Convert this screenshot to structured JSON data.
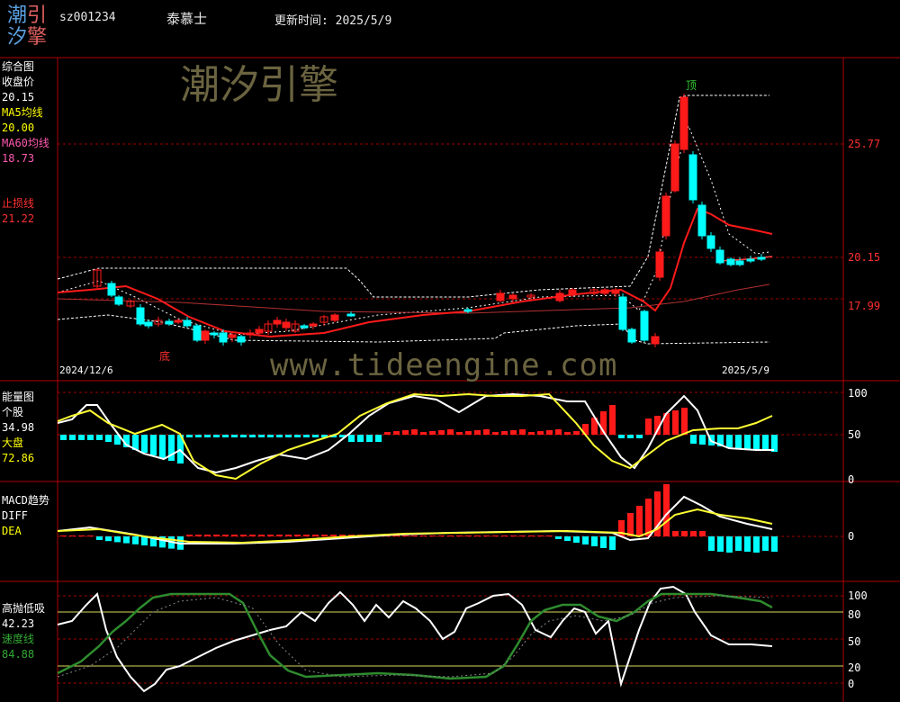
{
  "logo": {
    "chars": [
      "潮",
      "引",
      "汐",
      "擎"
    ]
  },
  "header": {
    "code": "sz001234",
    "name": "泰慕士",
    "update": "更新时间: 2025/5/9"
  },
  "watermarks": {
    "cn": "潮汐引擎",
    "url": "www.tideengine.com"
  },
  "panel1": {
    "title": "综合图",
    "close_label": "收盘价",
    "close_value": "20.15",
    "ma5_label": "MA5均线",
    "ma5_value": "20.00",
    "ma60_label": "MA60均线",
    "ma60_value": "18.73",
    "stop_label": "止损线",
    "stop_value": "21.22",
    "price_ticks": [
      "25.77",
      "20.15",
      "17.99"
    ],
    "date_start": "2024/12/6",
    "date_end": "2025/5/9",
    "mark_top": "顶",
    "mark_bottom": "底"
  },
  "panel2": {
    "title": "能量图",
    "stock_label": "个股",
    "stock_value": "34.98",
    "market_label": "大盘",
    "market_value": "72.86",
    "ticks": [
      "100",
      "50",
      "0"
    ]
  },
  "panel3": {
    "title": "MACD趋势",
    "diff_label": "DIFF",
    "dea_label": "DEA",
    "ticks": [
      "0"
    ]
  },
  "panel4": {
    "title": "高抛低吸",
    "value": "42.23",
    "speed_label": "速度线",
    "speed_value": "84.88",
    "ticks": [
      "100",
      "80",
      "50",
      "20",
      "0"
    ]
  },
  "colors": {
    "frame": "#c00000",
    "up": "#ff0000",
    "down": "#00ffff",
    "ma5": "#ffff00",
    "ma60": "#ff3333",
    "speed": "#228b22"
  }
}
